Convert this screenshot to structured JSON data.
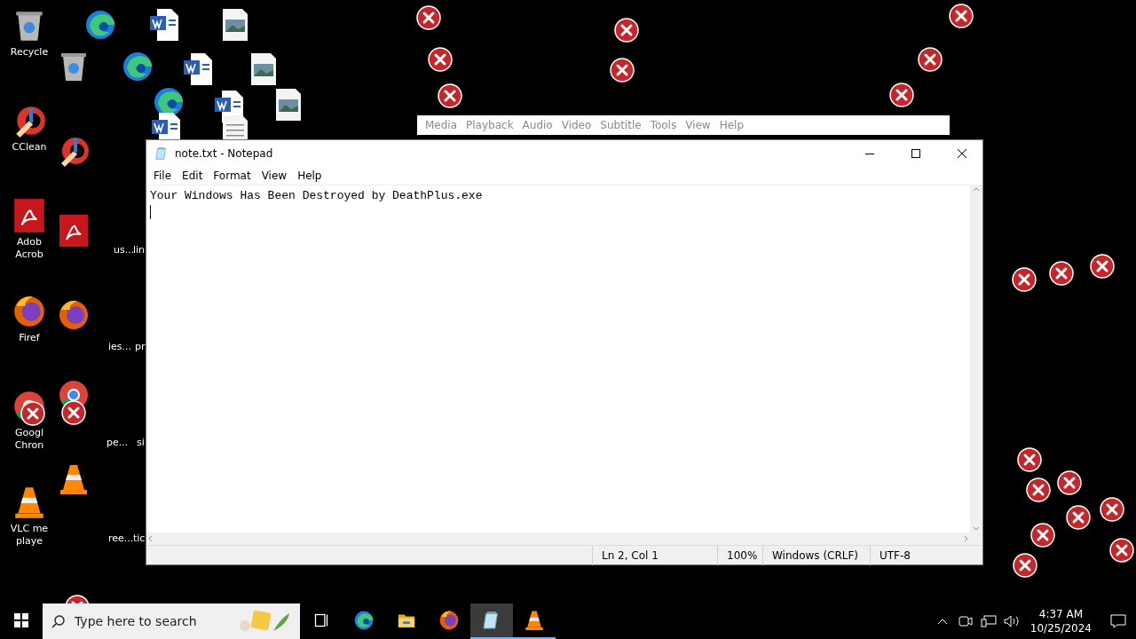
{
  "desktop": {
    "icons": [
      {
        "kind": "recycle",
        "lines": [
          "Recycle"
        ]
      },
      {
        "kind": "ccleaner",
        "lines": [
          "CClean"
        ]
      },
      {
        "kind": "acrobat",
        "lines": [
          "Adob",
          "Acrob"
        ]
      },
      {
        "kind": "firefox",
        "lines": [
          "Firef"
        ]
      },
      {
        "kind": "chrome",
        "lines": [
          "Googl",
          "Chron"
        ]
      },
      {
        "kind": "vlc",
        "lines": [
          "VLC me",
          "playe"
        ]
      }
    ],
    "ghost_icons": [
      {
        "kind": "recycle"
      },
      {
        "kind": "ccleaner"
      },
      {
        "kind": "acrobat"
      },
      {
        "kind": "firefox"
      },
      {
        "kind": "chrome"
      },
      {
        "kind": "vlc"
      },
      {
        "kind": "edge"
      },
      {
        "kind": "word"
      },
      {
        "kind": "image"
      },
      {
        "kind": "edge"
      },
      {
        "kind": "word"
      },
      {
        "kind": "image"
      },
      {
        "kind": "edge"
      },
      {
        "kind": "word"
      },
      {
        "kind": "image"
      },
      {
        "kind": "word"
      },
      {
        "kind": "text"
      }
    ],
    "fragments": [
      "us...",
      "lin",
      "ies...",
      "pr",
      "pe...",
      "si",
      "ree...",
      "tic"
    ]
  },
  "vlc_menu": {
    "items": [
      "Media",
      "Playback",
      "Audio",
      "Video",
      "Subtitle",
      "Tools",
      "View",
      "Help"
    ]
  },
  "notepad": {
    "title": "note.txt - Notepad",
    "menu": [
      "File",
      "Edit",
      "Format",
      "View",
      "Help"
    ],
    "text": "Your Windows Has Been Destroyed by DeathPlus.exe",
    "status": [
      "Ln 2, Col 1",
      "100%",
      "Windows (CRLF)",
      "UTF-8"
    ]
  },
  "taskbar": {
    "search": {
      "placeholder": "Type here to search"
    },
    "apps": [
      {
        "kind": "taskview",
        "selected": false,
        "running": false
      },
      {
        "kind": "edge",
        "selected": false,
        "running": false
      },
      {
        "kind": "explorer",
        "selected": false,
        "running": false
      },
      {
        "kind": "firefox",
        "selected": false,
        "running": false
      },
      {
        "kind": "notepad",
        "selected": true,
        "running": true
      },
      {
        "kind": "vlc",
        "selected": false,
        "running": true
      }
    ],
    "clock": {
      "time": "4:37 AM",
      "date": "10/25/2024"
    }
  }
}
